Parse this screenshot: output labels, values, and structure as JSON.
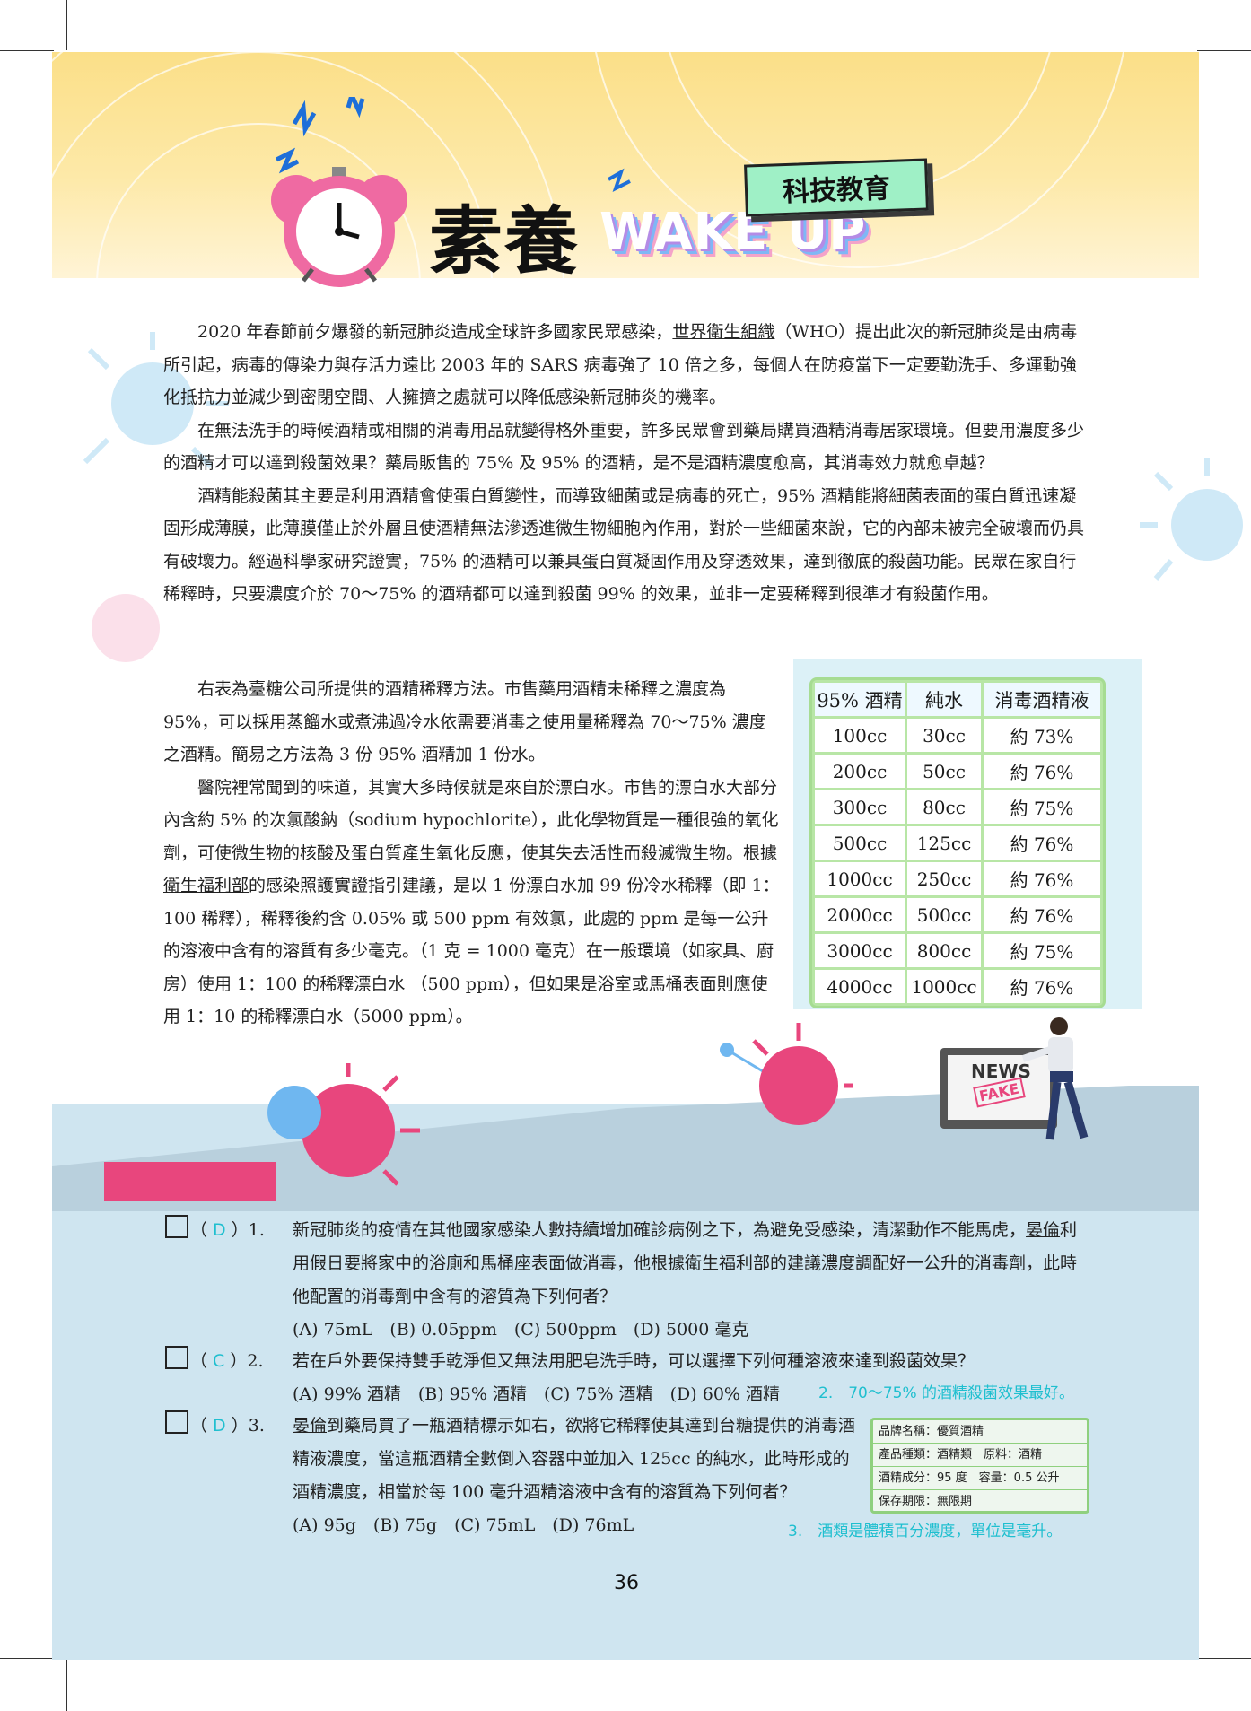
{
  "header": {
    "title_cn": "素養",
    "title_en": "WAKE UP",
    "tag": "科技教育"
  },
  "article": {
    "p1": [
      {
        "t": "2020 年春節前夕爆發的新冠肺炎造成全球許多國家民眾感染，"
      },
      {
        "t": "世界衛生組織",
        "u": true
      },
      {
        "t": "（WHO）提出此次的新冠肺炎是由病毒所引起，病毒的傳染力與存活力遠比 2003 年的 SARS 病毒強了 10 倍之多，每個人在防疫當下一定要勤洗手、多運動強化抵抗力並減少到密閉空間、人擁擠之處就可以降低感染新冠肺炎的機率。"
      }
    ],
    "p2": "在無法洗手的時候酒精或相關的消毒用品就變得格外重要，許多民眾會到藥局購買酒精消毒居家環境。但要用濃度多少的酒精才可以達到殺菌效果？藥局販售的 75% 及 95% 的酒精，是不是酒精濃度愈高，其消毒效力就愈卓越？",
    "p3": "酒精能殺菌其主要是利用酒精會使蛋白質變性，而導致細菌或是病毒的死亡，95% 酒精能將細菌表面的蛋白質迅速凝固形成薄膜，此薄膜僅止於外層且使酒精無法滲透進微生物細胞內作用，對於一些細菌來說，它的內部未被完全破壞而仍具有破壞力。經過科學家研究證實，75% 的酒精可以兼具蛋白質凝固作用及穿透效果，達到徹底的殺菌功能。民眾在家自行稀釋時，只要濃度介於 70～75% 的酒精都可以達到殺菌 99% 的效果，並非一定要稀釋到很準才有殺菌作用。",
    "p4": "右表為臺糖公司所提供的酒精稀釋方法。市售藥用酒精未稀釋之濃度為 95%，可以採用蒸餾水或煮沸過冷水依需要消毒之使用量稀釋為 70～75% 濃度之酒精。簡易之方法為 3 份 95% 酒精加 1 份水。",
    "p5": [
      {
        "t": "醫院裡常聞到的味道，其實大多時候就是來自於漂白水。市售的漂白水大部分內含約 5% 的次氯酸鈉（sodium hypochlorite），此化學物質是一種很強的氧化劑，可使微生物的核酸及蛋白質產生氧化反應，使其失去活性而殺滅微生物。根據"
      },
      {
        "t": "衛生福利部",
        "u": true
      },
      {
        "t": "的感染照護實證指引建議，是以 1 份漂白水加 99 份冷水稀釋（即 1：100 稀釋），稀釋後約含 0.05% 或 500 ppm 有效氯，此處的 ppm 是每一公升的溶液中含有的溶質有多少毫克。（1 克 = 1000 毫克）在一般環境（如家具、廚房）使用 1：100 的稀釋漂白水 （500 ppm），但如果是浴室或馬桶表面則應使用 1：10 的稀釋漂白水（5000 ppm）。"
      }
    ]
  },
  "table": {
    "headers": [
      "95% 酒精",
      "純水",
      "消毒酒精液"
    ],
    "rows": [
      [
        "100cc",
        "30cc",
        "約 73%"
      ],
      [
        "200cc",
        "50cc",
        "約 76%"
      ],
      [
        "300cc",
        "80cc",
        "約 75%"
      ],
      [
        "500cc",
        "125cc",
        "約 76%"
      ],
      [
        "1000cc",
        "250cc",
        "約 76%"
      ],
      [
        "2000cc",
        "500cc",
        "約 76%"
      ],
      [
        "3000cc",
        "800cc",
        "約 75%"
      ],
      [
        "4000cc",
        "1000cc",
        "約 76%"
      ]
    ]
  },
  "illustration": {
    "news": "NEWS",
    "fake": "FAKE"
  },
  "questions": [
    {
      "answer": "D",
      "num": "1.",
      "text": [
        {
          "t": "新冠肺炎的疫情在其他國家感染人數持續增加確診病例之下，為避免受感染，清潔動作不能馬虎，"
        },
        {
          "t": "晏倫",
          "u": true
        },
        {
          "t": "利用假日要將家中的浴廁和馬桶座表面做消毒，他根據"
        },
        {
          "t": "衛生福利部",
          "u": true
        },
        {
          "t": "的建議濃度調配好一公升的消毒劑，此時他配置的消毒劑中含有的溶質為下列何者？"
        }
      ],
      "options": "(A) 75mL　(B) 0.05ppm　(C) 500ppm　(D) 5000 毫克"
    },
    {
      "answer": "C",
      "num": "2.",
      "text": [
        {
          "t": "若在戶外要保持雙手乾淨但又無法用肥皂洗手時，可以選擇下列何種溶液來達到殺菌效果？"
        }
      ],
      "options": "(A) 99% 酒精　(B) 95% 酒精　(C) 75% 酒精　(D) 60% 酒精",
      "note": "2.　70～75% 的酒精殺菌效果最好。"
    },
    {
      "answer": "D",
      "num": "3.",
      "text": [
        {
          "t": "晏倫",
          "u": true
        },
        {
          "t": "到藥局買了一瓶酒精標示如右，欲將它稀釋使其達到台糖提供的消毒酒精液濃度，當這瓶酒精全數倒入容器中並加入 125cc 的純水，此時形成的酒精濃度，相當於每 100 毫升酒精溶液中含有的溶質為下列何者？"
        }
      ],
      "options": "(A) 95g　(B) 75g　(C) 75mL　(D) 76mL",
      "note": "3.　酒類是體積百分濃度，單位是毫升。"
    }
  ],
  "product_label": {
    "line1": "品牌名稱：優質酒精",
    "line2": "產品種類：酒精類　原料：酒精",
    "line3": "酒精成分：95 度　容量：0.5 公升",
    "line4": "保存期限：無限期"
  },
  "page_number": "36",
  "colors": {
    "accent_pink": "#e8467d",
    "answer_cyan": "#1fbfcf",
    "table_green": "#b8e6a6",
    "banner_yellow": "#fbdf88"
  }
}
